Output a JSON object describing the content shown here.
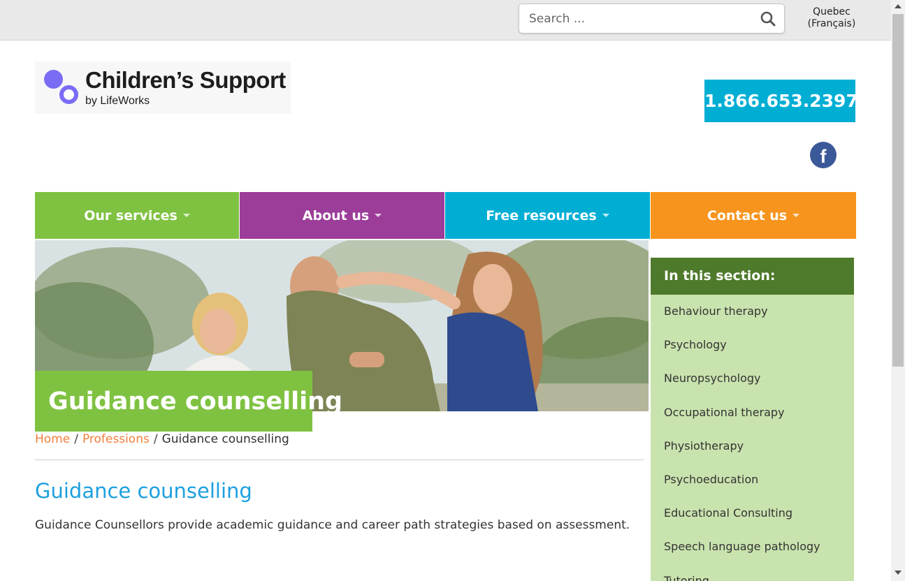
{
  "search": {
    "placeholder": "Search ..."
  },
  "language_switch": {
    "line1": "Quebec",
    "line2": "(Français)"
  },
  "logo": {
    "name": "Children’s Support",
    "byline": "by LifeWorks"
  },
  "phone": "1.866.653.2397",
  "social": {
    "facebook_letter": "f"
  },
  "nav": [
    {
      "label": "Our services",
      "color": "#7fc241"
    },
    {
      "label": "About us",
      "color": "#9b3d99"
    },
    {
      "label": "Free resources",
      "color": "#00aed4"
    },
    {
      "label": "Contact us",
      "color": "#f7941d"
    }
  ],
  "hero": {
    "title": "Guidance counselling"
  },
  "breadcrumb": {
    "home": "Home",
    "section": "Professions",
    "current": "Guidance counselling",
    "separator": "/"
  },
  "main": {
    "title": "Guidance counselling",
    "intro": "Guidance Counsellors provide academic guidance and career path strategies based on assessment."
  },
  "sidebar": {
    "heading": "In this section:",
    "items": [
      {
        "label": "Behaviour therapy"
      },
      {
        "label": "Psychology"
      },
      {
        "label": "Neuropsychology"
      },
      {
        "label": "Occupational therapy"
      },
      {
        "label": "Physiotherapy"
      },
      {
        "label": "Psychoeducation"
      },
      {
        "label": "Educational Consulting"
      },
      {
        "label": "Speech language pathology"
      },
      {
        "label": "Tutoring"
      }
    ]
  },
  "colors": {
    "link_orange": "#f07f3c",
    "title_blue": "#1da0de",
    "sidebar_head": "#4e7a2b",
    "sidebar_bg": "#c9e3ae"
  }
}
